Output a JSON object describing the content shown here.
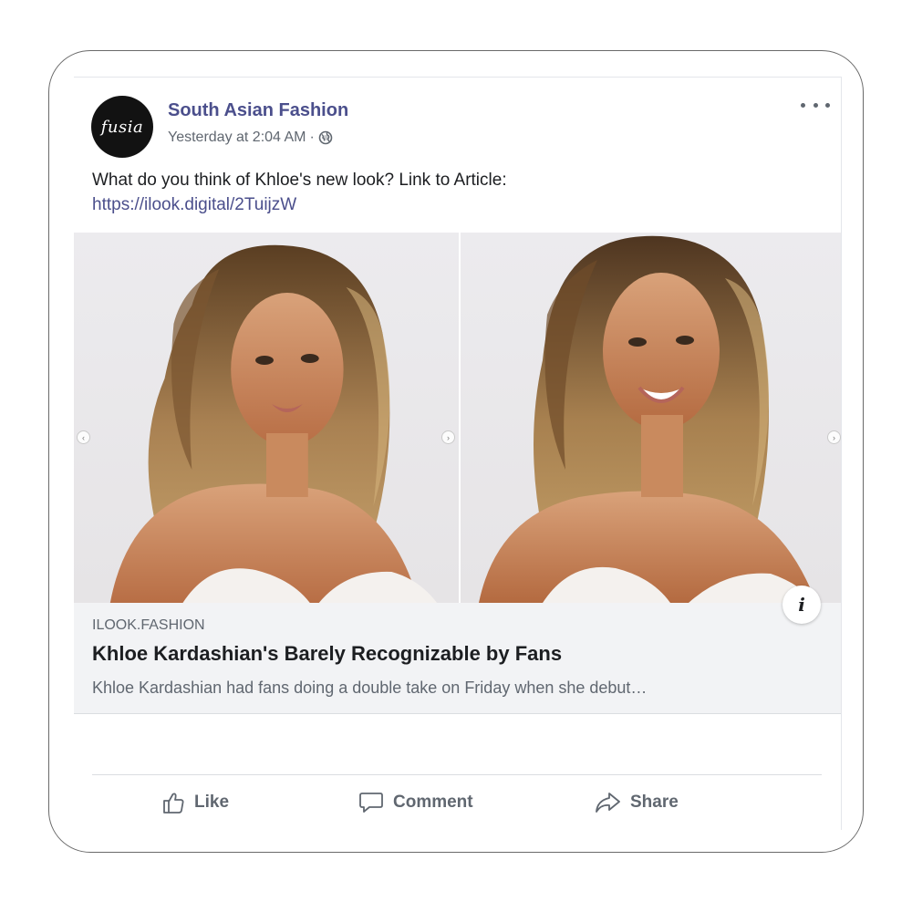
{
  "post": {
    "avatar_text": "fusia",
    "page_name": "South Asian Fashion",
    "timestamp": "Yesterday at 2:04 AM",
    "separator": "·",
    "text": "What do you think of Khloe's new look? Link to Article:",
    "link": "https://ilook.digital/2TuijzW"
  },
  "media": {
    "icons": [
      "chevron-left-icon",
      "chevron-right-icon",
      "info-icon",
      "globe-icon",
      "more-icon"
    ]
  },
  "preview": {
    "domain": "ILOOK.FASHION",
    "headline": "Khloe Kardashian's Barely Recognizable by Fans",
    "description": "Khloe Kardashian had fans doing a double take on Friday when she debut…",
    "info_label": "i"
  },
  "actions": {
    "like": "Like",
    "comment": "Comment",
    "share": "Share"
  },
  "colors": {
    "page_name": "#4b4f8c",
    "text": "#1c1e21",
    "muted": "#606770",
    "preview_bg": "#f2f3f5"
  }
}
